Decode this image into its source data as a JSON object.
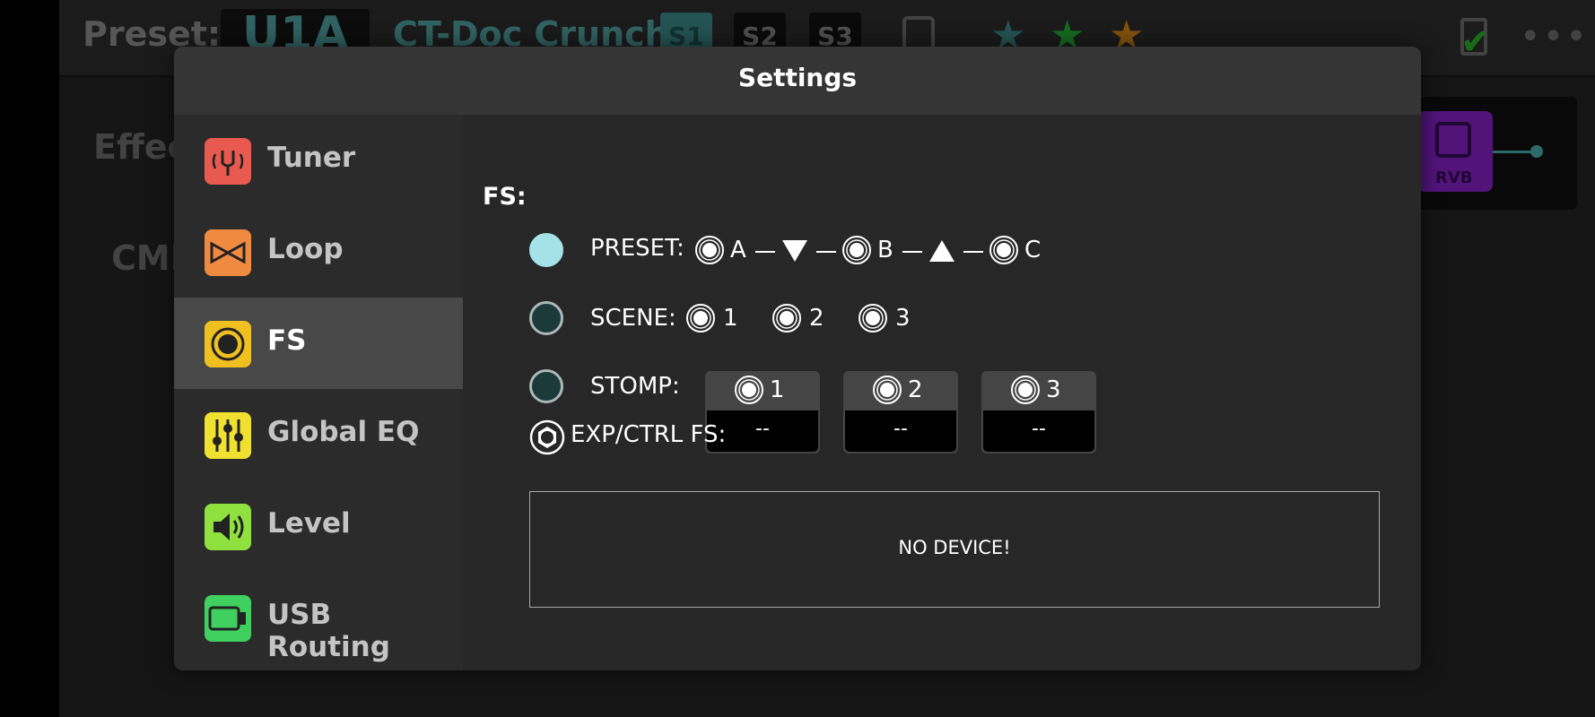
{
  "app": {
    "preset_label": "Preset:",
    "preset_code": "U1A",
    "preset_name": "CT-Doc Crunch",
    "scenes": [
      "S1",
      "S2",
      "S3"
    ],
    "active_scene": "S1",
    "stars": [
      {
        "icon": "star-icon",
        "color": "#2f6b6b"
      },
      {
        "icon": "star-icon",
        "color": "#1b8a2a"
      },
      {
        "icon": "star-icon",
        "color": "#a86a10"
      }
    ],
    "more_label": "•••",
    "bg_effects_label": "Effec",
    "bg_cmd_label": "CMI",
    "rvb_label": "RVB"
  },
  "settings": {
    "title": "Settings",
    "sidebar": [
      {
        "label": "Tuner",
        "icon": "tuning-fork-icon",
        "color": "#e85a50"
      },
      {
        "label": "Loop",
        "icon": "loop-icon",
        "color": "#f08a40"
      },
      {
        "label": "FS",
        "icon": "footswitch-icon",
        "color": "#f0c020",
        "active": true
      },
      {
        "label": "Global EQ",
        "icon": "eq-sliders-icon",
        "color": "#f0e030"
      },
      {
        "label": "Level",
        "icon": "speaker-icon",
        "color": "#90e040"
      },
      {
        "label": "USB Routing",
        "icon": "usb-icon",
        "color": "#40d060"
      }
    ],
    "fs": {
      "heading": "FS:",
      "modes": {
        "preset": {
          "label": "PRESET:",
          "selected": true,
          "options": [
            "A",
            "B",
            "C"
          ],
          "arrows": [
            "down-triangle-icon",
            "up-triangle-icon"
          ]
        },
        "scene": {
          "label": "SCENE:",
          "selected": false,
          "options": [
            "1",
            "2",
            "3"
          ]
        },
        "stomp": {
          "label": "STOMP:",
          "selected": false,
          "options": [
            {
              "num": "1",
              "value": "--"
            },
            {
              "num": "2",
              "value": "--"
            },
            {
              "num": "3",
              "value": "--"
            }
          ]
        }
      },
      "exp_ctrl_label": "EXP/CTRL FS:",
      "device_status": "NO DEVICE!"
    }
  }
}
